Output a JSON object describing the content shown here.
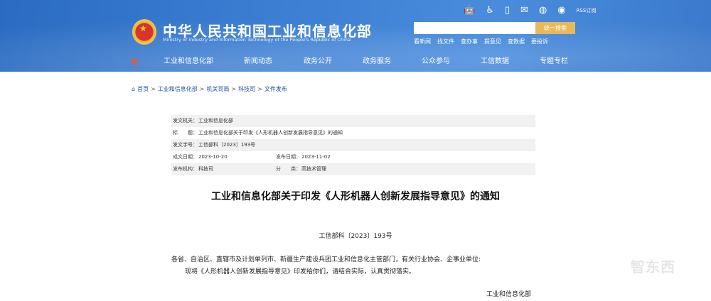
{
  "header": {
    "site_title": "中华人民共和国工业和信息化部",
    "site_subtitle": "Ministry of Industry and Information Technology of the People's Republic of China",
    "top_icons": [
      "robot-icon",
      "accessibility-icon",
      "mobile-icon",
      "mail-icon",
      "wechat-icon",
      "weibo-icon"
    ],
    "rss_label": "RSS订阅",
    "search_placeholder": "",
    "search_button": "统一搜索",
    "quick_links": [
      "看新闻",
      "找文件",
      "查办事",
      "提意见",
      "查数据",
      "要投诉"
    ]
  },
  "nav": {
    "items": [
      "工业和信息化部",
      "新闻动态",
      "政务公开",
      "政务服务",
      "公众参与",
      "工信数据",
      "专题专栏"
    ]
  },
  "breadcrumb": [
    "首页",
    "工业和信息化部",
    "机关司局",
    "科技司",
    "文件发布"
  ],
  "info": {
    "issuer_label": "发文机关：",
    "issuer": "工业和信息化部",
    "title_label": "标　　题：",
    "title": "工业和信息化部关于印发《人形机器人创新发展指导意见》的通知",
    "docno_label": "发文字号：",
    "docno": "工信部科〔2023〕193号",
    "written_label": "成文日期：",
    "written": "2023-10-20",
    "published_label": "发布日期：",
    "published": "2023-11-02",
    "org_label": "发布机构：",
    "org": "科技司",
    "category_label": "分　　类：",
    "category": "高技术管理"
  },
  "document": {
    "title": "工业和信息化部关于印发《人形机器人创新发展指导意见》的通知",
    "number": "工信部科〔2023〕193号",
    "addressee": "各省、自治区、直辖市及计划单列市、新疆生产建设兵团工业和信息化主管部门，有关行业协会、企事业单位:",
    "body": "现将《人形机器人创新发展指导意见》印发给你们，请结合实际，认真贯彻落实。",
    "signature": "工业和信息化部"
  },
  "watermark": "智东西"
}
